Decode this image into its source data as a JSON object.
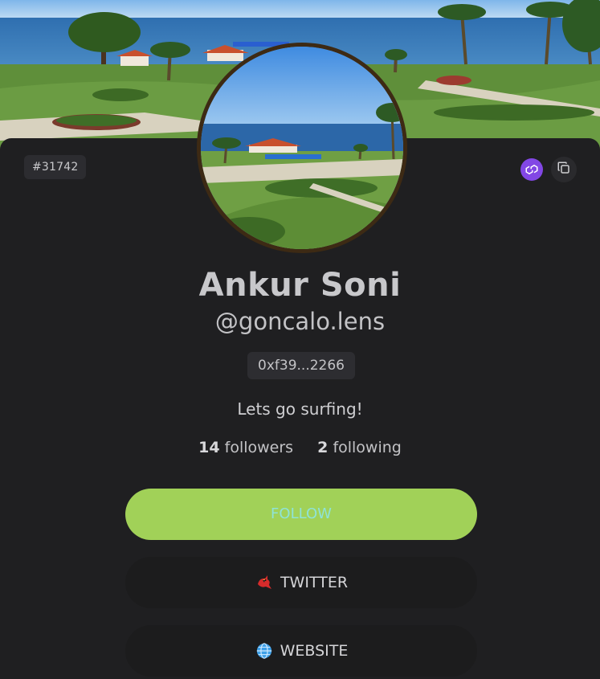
{
  "profile": {
    "token_id": "#31742",
    "name": "Ankur Soni",
    "handle": "@goncalo.lens",
    "address": "0xf39...2266",
    "bio": "Lets go surfing!",
    "followers_count": "14",
    "followers_label": "followers",
    "following_count": "2",
    "following_label": "following"
  },
  "buttons": {
    "follow": "FOLLOW",
    "twitter": "TWITTER",
    "website": "WEBSITE"
  },
  "icons": {
    "chain": "polygon-icon",
    "copy": "copy-icon",
    "twitter": "cardinal-bird-icon",
    "website": "globe-icon"
  },
  "colors": {
    "follow_bg": "#a1d158",
    "follow_text": "#8fe3d6",
    "chain_badge": "#8247e5",
    "card_bg": "#1f1f21"
  }
}
